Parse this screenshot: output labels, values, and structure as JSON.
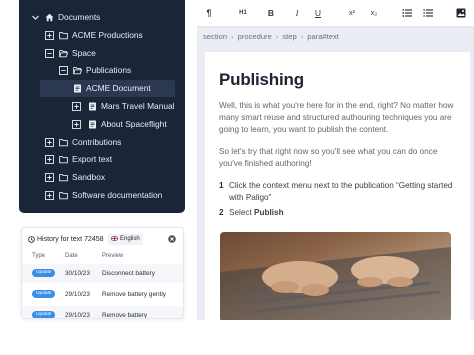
{
  "nav": {
    "items": [
      {
        "label": "Documents",
        "icon": "home-icon",
        "toggle": "chevron-down-icon"
      },
      {
        "label": "ACME Productions",
        "icon": "folder-icon",
        "toggle": "plus-box-icon"
      },
      {
        "label": "Space",
        "icon": "folder-icon",
        "toggle": "minus-box-icon"
      },
      {
        "label": "Publications",
        "icon": "folder-icon",
        "toggle": "minus-box-icon"
      },
      {
        "label": "ACME Document",
        "icon": "document-icon",
        "selected": true
      },
      {
        "label": "Mars Travel Manual",
        "icon": "document-icon",
        "toggle": "plus-box-icon"
      },
      {
        "label": "About Spaceflight",
        "icon": "document-icon",
        "toggle": "plus-box-icon"
      },
      {
        "label": "Contributions",
        "icon": "folder-icon",
        "toggle": "plus-box-icon"
      },
      {
        "label": "Export text",
        "icon": "folder-icon",
        "toggle": "plus-box-icon"
      },
      {
        "label": "Sandbox",
        "icon": "folder-icon",
        "toggle": "plus-box-icon"
      },
      {
        "label": "Software documentation",
        "icon": "folder-icon",
        "toggle": "plus-box-icon"
      }
    ],
    "colors": {
      "background": "#1b2538",
      "selected": "#2c3850",
      "text": "#e8ecf3"
    }
  },
  "history": {
    "title": "History for text 72458",
    "language": "English",
    "columns": [
      "Type",
      "Date",
      "Preview"
    ],
    "rows": [
      {
        "type": "Update",
        "date": "30/10/23",
        "preview": "Disconnect battery"
      },
      {
        "type": "Update",
        "date": "29/10/23",
        "preview": "Remove battery gently"
      },
      {
        "type": "Update",
        "date": "29/10/23",
        "preview": "Remove battery"
      }
    ],
    "badge_color": "#3a8ee6"
  },
  "toolbar": {
    "heading_label": "H1",
    "bold": "B",
    "italic": "I",
    "underline": "U",
    "superscript": "x²",
    "subscript": "x₂",
    "icons": [
      "paragraph-icon",
      "heading-icon",
      "bold-icon",
      "italic-icon",
      "underline-icon",
      "superscript-icon",
      "subscript-icon",
      "bullet-list-icon",
      "numbered-list-icon",
      "image-icon"
    ]
  },
  "breadcrumb": [
    "section",
    "procedure",
    "step",
    "para#text"
  ],
  "document": {
    "title": "Publishing",
    "para1": "Well, this is what you're here for in the end, right? No matter how many smart reuse and structured authouring techniques you are going to learn, you want to publish the content.",
    "para2": "So let's try that right now so you'll see what you can do once you've finished authoring!",
    "steps": [
      {
        "num": "1",
        "text": "Click the context menu next to the publication “Getting started with Paligo”"
      },
      {
        "num": "2",
        "text_prefix": "Select ",
        "text_bold": "Publish"
      }
    ]
  }
}
